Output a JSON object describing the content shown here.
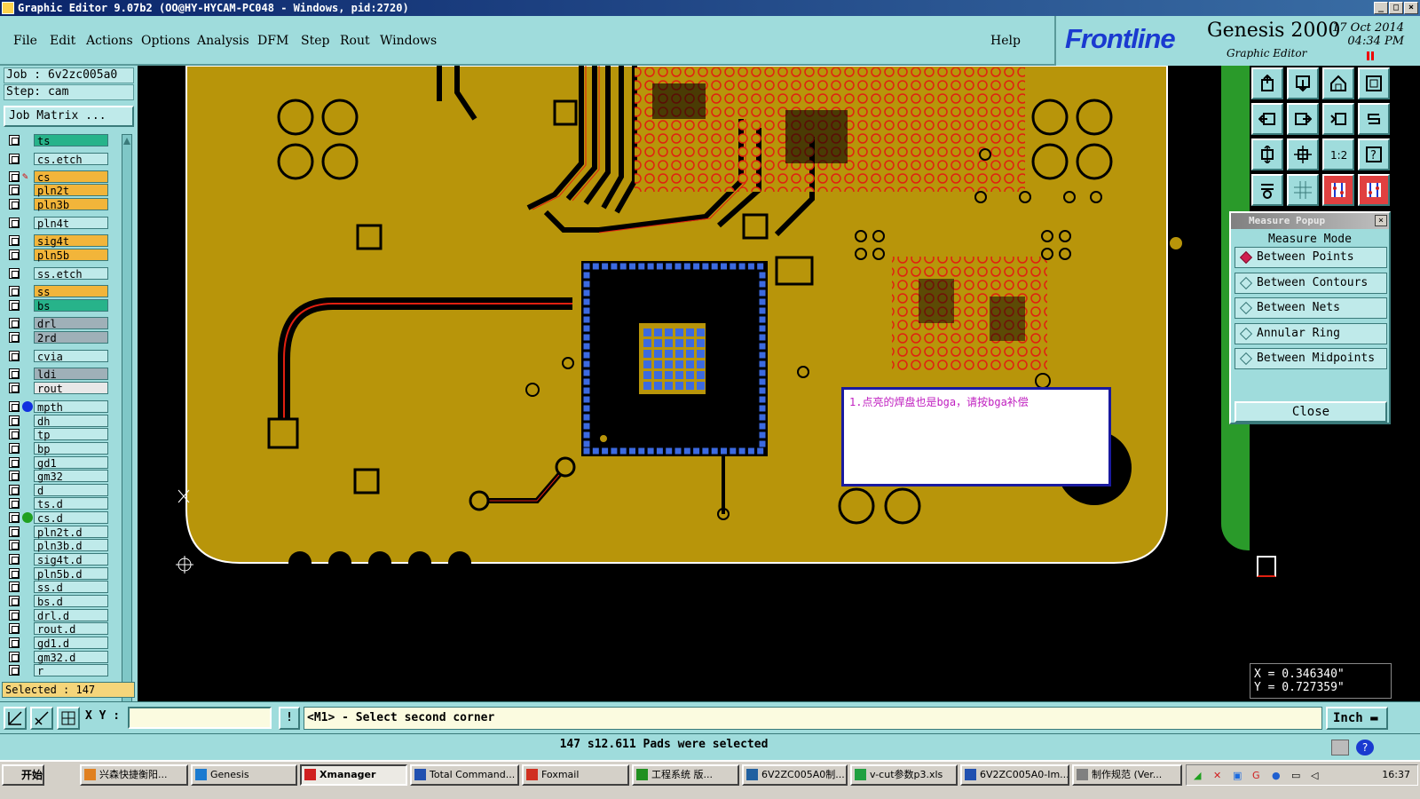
{
  "window": {
    "title": "Graphic Editor 9.07b2 (OO@HY-HYCAM-PC048 - Windows, pid:2720)"
  },
  "menu": {
    "items": [
      "File",
      "Edit",
      "Actions",
      "Options",
      "Analysis",
      "DFM",
      "Step",
      "Rout",
      "Windows"
    ],
    "help": "Help"
  },
  "brand": {
    "logo": "Frontline",
    "product": "Genesis 2000",
    "subtitle": "Graphic Editor",
    "date": "17 Oct 2014",
    "time": "04:34 PM"
  },
  "job": {
    "job_label": "Job : 6v2zc005a0",
    "step_label": "Step: cam",
    "matrix_button": "Job Matrix ..."
  },
  "layers": [
    {
      "name": "ts",
      "color": "#27b38a"
    },
    {
      "name": "cs.etch",
      "color": "#bfeaea"
    },
    {
      "name": "cs",
      "color": "#f2b53a",
      "work": true
    },
    {
      "name": "pln2t",
      "color": "#f2b53a"
    },
    {
      "name": "pln3b",
      "color": "#f2b53a"
    },
    {
      "name": "pln4t",
      "color": "#bfeaea"
    },
    {
      "name": "sig4t",
      "color": "#f2b53a"
    },
    {
      "name": "pln5b",
      "color": "#f2b53a"
    },
    {
      "name": "ss.etch",
      "color": "#bfeaea"
    },
    {
      "name": "ss",
      "color": "#f2b53a"
    },
    {
      "name": "bs",
      "color": "#27b38a"
    },
    {
      "name": "drl",
      "color": "#9fb0b8"
    },
    {
      "name": "2rd",
      "color": "#9fb0b8"
    },
    {
      "name": "cvia",
      "color": "#bfeaea"
    },
    {
      "name": "ldi",
      "color": "#9fb0b8"
    },
    {
      "name": "rout",
      "color": "#e8e8e8"
    },
    {
      "name": "mpth",
      "color": "#bfeaea",
      "dot": "#1030e0"
    },
    {
      "name": "dh",
      "color": "#bfeaea"
    },
    {
      "name": "tp",
      "color": "#bfeaea"
    },
    {
      "name": "bp",
      "color": "#bfeaea"
    },
    {
      "name": "gd1",
      "color": "#bfeaea"
    },
    {
      "name": "gm32",
      "color": "#bfeaea"
    },
    {
      "name": "d",
      "color": "#bfeaea"
    },
    {
      "name": "ts.d",
      "color": "#bfeaea"
    },
    {
      "name": "cs.d",
      "color": "#bfeaea",
      "dot": "#20a020"
    },
    {
      "name": "pln2t.d",
      "color": "#bfeaea"
    },
    {
      "name": "pln3b.d",
      "color": "#bfeaea"
    },
    {
      "name": "sig4t.d",
      "color": "#bfeaea"
    },
    {
      "name": "pln5b.d",
      "color": "#bfeaea"
    },
    {
      "name": "ss.d",
      "color": "#bfeaea"
    },
    {
      "name": "bs.d",
      "color": "#bfeaea"
    },
    {
      "name": "drl.d",
      "color": "#bfeaea"
    },
    {
      "name": "rout.d",
      "color": "#bfeaea"
    },
    {
      "name": "gd1.d",
      "color": "#bfeaea"
    },
    {
      "name": "gm32.d",
      "color": "#bfeaea"
    },
    {
      "name": "r",
      "color": "#bfeaea"
    }
  ],
  "selected_label": "Selected : 147",
  "measure": {
    "title": "Measure Popup",
    "mode_label": "Measure Mode",
    "options": [
      "Between Points",
      "Between Contours",
      "Between Nets",
      "Annular Ring",
      "Between Midpoints"
    ],
    "selected": "Between Points",
    "close_label": "Close"
  },
  "note": {
    "text": "1.点亮的焊盘也是bga，请按bga补偿"
  },
  "coords": {
    "x": "X = 0.346340\"",
    "y": "Y = 0.727359\""
  },
  "command": {
    "xy_label": "X Y :",
    "xy_value": "",
    "excl": "!",
    "prompt": "<M1> - Select second corner",
    "unit": "Inch"
  },
  "status": {
    "text": "147 s12.611 Pads were selected"
  },
  "taskbar": {
    "start": "开始",
    "tasks": [
      "兴森快捷衡阳...",
      "Genesis",
      "Xmanager",
      "Total Command...",
      "Foxmail",
      "工程系统   版...",
      "6V2ZC005A0制...",
      "v-cut参数p3.xls",
      "6V2ZC005A0-Im...",
      "制作规范 (Ver..."
    ],
    "active": "Xmanager",
    "clock": "16:37"
  },
  "colors": {
    "board": "#b8950a",
    "copper_outline": "#e02010",
    "selected_pad": "#3c6ae0",
    "panel": "#9fdcdc"
  }
}
